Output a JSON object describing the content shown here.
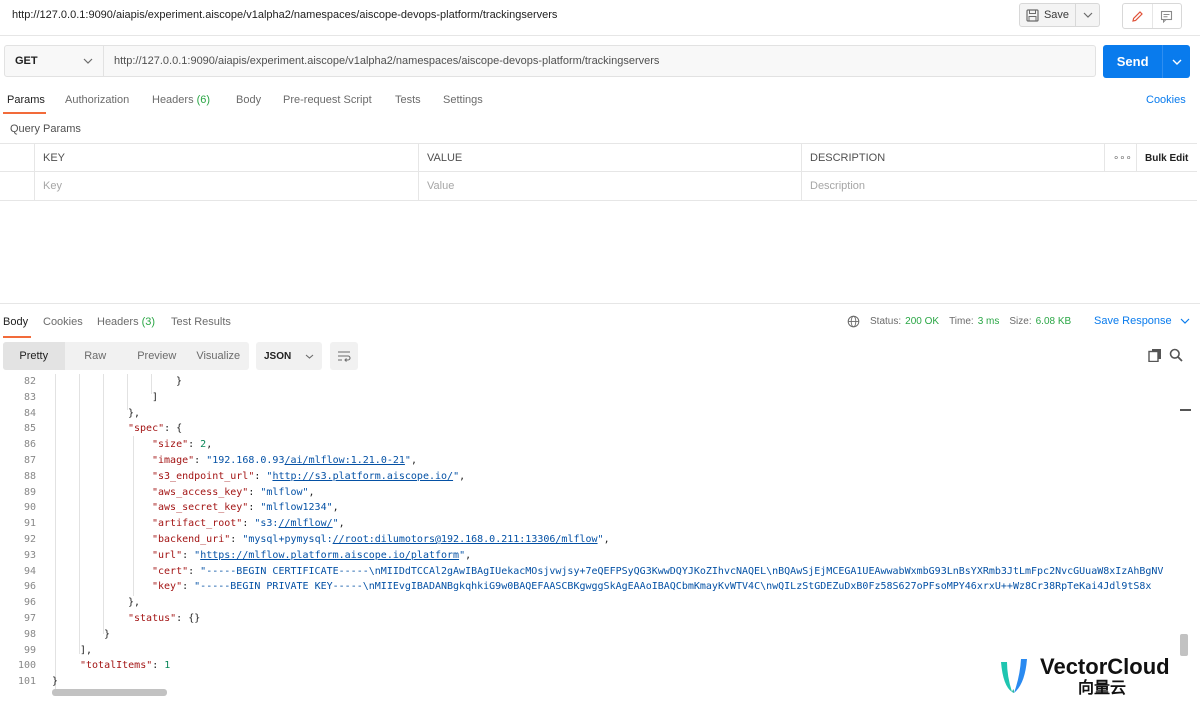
{
  "request": {
    "title": "http://127.0.0.1:9090/aiapis/experiment.aiscope/v1alpha2/namespaces/aiscope-devops-platform/trackingservers",
    "save_label": "Save",
    "method": "GET",
    "url": "http://127.0.0.1:9090/aiapis/experiment.aiscope/v1alpha2/namespaces/aiscope-devops-platform/trackingservers",
    "send_label": "Send"
  },
  "request_tabs": {
    "params": "Params",
    "authorization": "Authorization",
    "headers": "Headers",
    "headers_count": "(6)",
    "body": "Body",
    "prerequest": "Pre-request Script",
    "tests": "Tests",
    "settings": "Settings",
    "cookies": "Cookies"
  },
  "query_params": {
    "label": "Query Params",
    "headers": {
      "key": "KEY",
      "value": "VALUE",
      "description": "DESCRIPTION",
      "more": "∘∘∘",
      "bulk_edit": "Bulk Edit"
    },
    "placeholders": {
      "key": "Key",
      "value": "Value",
      "description": "Description"
    }
  },
  "response_tabs": {
    "body": "Body",
    "cookies": "Cookies",
    "headers": "Headers",
    "headers_count": "(3)",
    "test_results": "Test Results"
  },
  "response_status": {
    "status_label": "Status:",
    "status_value": "200 OK",
    "time_label": "Time:",
    "time_value": "3 ms",
    "size_label": "Size:",
    "size_value": "6.08 KB",
    "save_response": "Save Response"
  },
  "view_modes": {
    "pretty": "Pretty",
    "raw": "Raw",
    "preview": "Preview",
    "visualize": "Visualize",
    "format": "JSON"
  },
  "code_lines": {
    "82": "}",
    "83": "]",
    "84": "},",
    "85": {
      "key": "\"spec\"",
      "rest": ": {"
    },
    "86": {
      "key": "\"size\"",
      "num": "2"
    },
    "87": {
      "key": "\"image\"",
      "pre": "\"192.168.0.93",
      "link": "/ai/mlflow:1.21.0-21",
      "post": "\""
    },
    "88": {
      "key": "\"s3_endpoint_url\"",
      "pre": "\"",
      "link": "http://s3.platform.aiscope.io/",
      "post": "\""
    },
    "89": {
      "key": "\"aws_access_key\"",
      "value": "\"mlflow\""
    },
    "90": {
      "key": "\"aws_secret_key\"",
      "value": "\"mlflow1234\""
    },
    "91": {
      "key": "\"artifact_root\"",
      "pre": "\"s3:",
      "link": "//mlflow/",
      "post": "\""
    },
    "92": {
      "key": "\"backend_uri\"",
      "pre": "\"mysql+pymysql:",
      "link": "//root:dilumotors@192.168.0.211:13306/mlflow",
      "post": "\""
    },
    "93": {
      "key": "\"url\"",
      "pre": "\"",
      "link": "https://mlflow.platform.aiscope.io/platform",
      "post": "\""
    },
    "94": {
      "key": "\"cert\"",
      "value": "\"-----BEGIN CERTIFICATE-----\\nMIIDdTCCAl2gAwIBAgIUekacMOsjvwjsy+7eQEFPSyQG3KwwDQYJKoZIhvcNAQEL\\nBQAwSjEjMCEGA1UEAwwabWxmbG93LnBsYXRmb3JtLmFpc2NvcGUuaW8xIzAhBgNV"
    },
    "96": {
      "key": "\"key\"",
      "value": "\"-----BEGIN PRIVATE KEY-----\\nMIIEvgIBADANBgkqhkiG9w0BAQEFAASCBKgwggSkAgEAAoIBAQCbmKmayKvWTV4C\\nwQILzStGDEZuDxB0Fz58S627oPFsoMPY46xrxU++Wz8Cr38RpTeKai4Jdl9tS8x"
    },
    "97": "},",
    "98": {
      "key": "\"status\"",
      "rest": ": {}"
    },
    "99": "}",
    "100": "],",
    "101": {
      "key": "\"totalItems\"",
      "num": "1"
    },
    "102": "}"
  },
  "line_numbers": [
    "82",
    "83",
    "84",
    "85",
    "86",
    "87",
    "88",
    "89",
    "90",
    "91",
    "92",
    "93",
    "94",
    "96",
    "96",
    "97",
    "98",
    "99",
    "100",
    "101"
  ],
  "watermark": {
    "en": "VectorCloud",
    "cn": "向量云"
  },
  "colors": {
    "accent": "#097bed",
    "active_tab": "#f26b3a",
    "status_ok": "#2aa645"
  }
}
